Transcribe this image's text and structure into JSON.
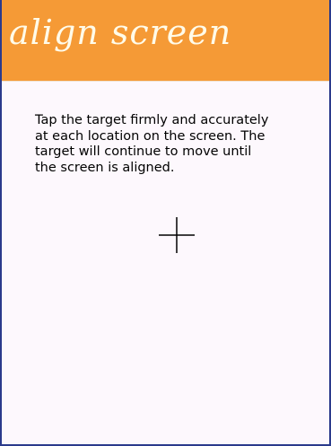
{
  "header": {
    "title": "align screen",
    "background_color": "#f59a36",
    "title_color": "#fffbe9"
  },
  "instructions": {
    "lines": [
      "Tap the target firmly and accurately",
      "at each location on the screen. The",
      "target will continue to move until",
      "the screen is aligned."
    ]
  },
  "target": {
    "icon": "crosshair-icon"
  }
}
